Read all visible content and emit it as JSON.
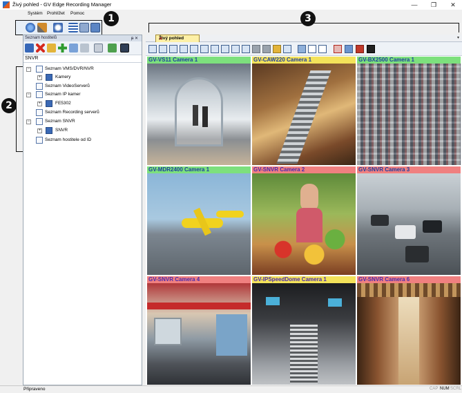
{
  "window": {
    "title": "Živý pohled - GV Edge Recording Manager",
    "controls": [
      "—",
      "❐",
      "✕"
    ]
  },
  "menu": {
    "items": [
      "Systém",
      "Prohlížet",
      "Pomoc"
    ]
  },
  "callouts": [
    "1",
    "2",
    "3"
  ],
  "left_panel": {
    "title": "Seznam hostitelů",
    "pin": "ᵽ ✕",
    "path": "SNVR",
    "tree": [
      {
        "label": "Seznam VMS/DVR/NVR",
        "expander": "−",
        "icon": "list-icon"
      },
      {
        "label": "Kamery",
        "expander": "+",
        "icon": "camera-icon"
      },
      {
        "label": "Seznam VideoServerů",
        "expander": "",
        "icon": "list-icon"
      },
      {
        "label": "Seznam IP kamer",
        "expander": "−",
        "icon": "list-icon"
      },
      {
        "label": "FE5302",
        "expander": "+",
        "icon": "camera-icon"
      },
      {
        "label": "Seznam Recording serverů",
        "expander": "",
        "icon": "list-icon"
      },
      {
        "label": "Seznam SNVR",
        "expander": "−",
        "icon": "list-icon"
      },
      {
        "label": "SNVR",
        "expander": "+",
        "icon": "camera-icon"
      },
      {
        "label": "Seznam hostitele od ID",
        "expander": "",
        "icon": "list-icon"
      }
    ]
  },
  "main": {
    "tab": {
      "label": "Živý pohled",
      "close": "✕"
    },
    "tab_menu": "▾",
    "cameras": [
      {
        "label": "GV-VS11 Camera 1",
        "label_bg": "#7de07d",
        "label_fg": "#1e3fa0"
      },
      {
        "label": "GV-CAW220 Camera 1",
        "label_bg": "#f3e25a",
        "label_fg": "#1e3fa0"
      },
      {
        "label": "GV-BX2500 Camera 1",
        "label_bg": "#7de07d",
        "label_fg": "#1e3fa0"
      },
      {
        "label": "GV-MDR2400 Camera 1",
        "label_bg": "#7de07d",
        "label_fg": "#1e3fa0"
      },
      {
        "label": "GV-SNVR Camera 2",
        "label_bg": "#f08080",
        "label_fg": "#4a2bb0"
      },
      {
        "label": "GV-SNVR Camera 3",
        "label_bg": "#f08080",
        "label_fg": "#1e3fa0"
      },
      {
        "label": "GV-SNVR Camera 4",
        "label_bg": "#f08080",
        "label_fg": "#4a2bb0"
      },
      {
        "label": "GV-IPSpeedDome Camera 1",
        "label_bg": "#f3e25a",
        "label_fg": "#4a2bb0"
      },
      {
        "label": "GV-SNVR Camera 6",
        "label_bg": "#f08080",
        "label_fg": "#4a2bb0"
      }
    ]
  },
  "status": {
    "left": "Připraveno",
    "caps": "CAP",
    "num": "NUM",
    "scrl": "SCRL"
  }
}
